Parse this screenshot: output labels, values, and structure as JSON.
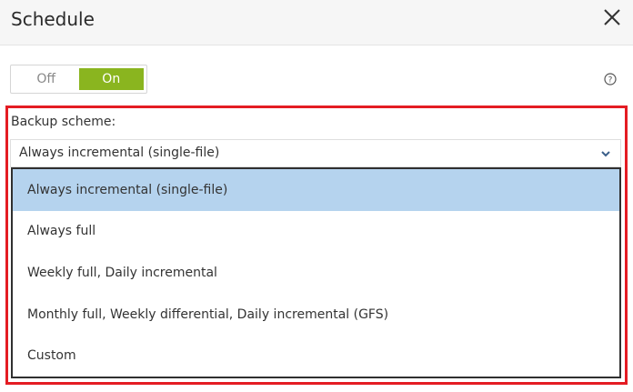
{
  "dialog": {
    "title": "Schedule"
  },
  "toggle": {
    "off_label": "Off",
    "on_label": "On",
    "state": "On"
  },
  "backup_scheme": {
    "label": "Backup scheme:",
    "selected": "Always incremental (single-file)",
    "options": [
      "Always incremental (single-file)",
      "Always full",
      "Weekly full, Daily incremental",
      "Monthly full, Weekly differential, Daily incremental (GFS)",
      "Custom"
    ]
  },
  "colors": {
    "toggle_active": "#8ab51f",
    "option_selected": "#b5d3ee",
    "highlight_border": "#e41c23"
  },
  "icons": {
    "close": "close-icon",
    "help": "help-icon",
    "chevron": "chevron-down-icon"
  }
}
